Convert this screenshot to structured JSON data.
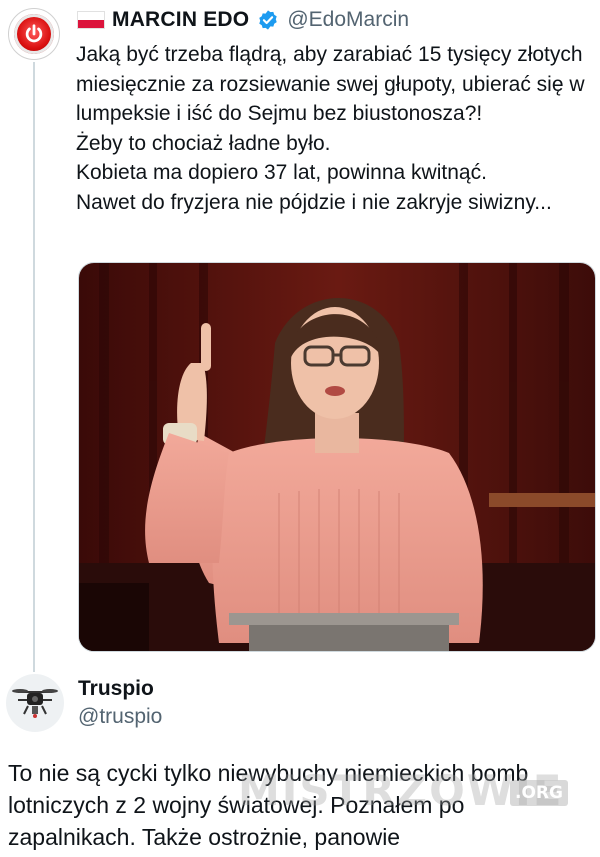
{
  "tweet1": {
    "display_name": "MARCIN EDO",
    "handle": "@EdoMarcin",
    "flag_colors": [
      "#ffffff",
      "#dc143c"
    ],
    "verified_color": "#1d9bf0",
    "lines": [
      "Jaką być trzeba flądrą, aby zarabiać 15 tysięcy złotych miesięcznie za rozsiewanie swej głupoty, ubierać się w lumpeksie i iść do Sejmu bez biustonosza?!",
      "Żeby to chociaż ładne było.",
      "Kobieta ma dopiero 37 lat, powinna kwitnąć.",
      "Nawet do fryzjera nie pójdzie i nie zakryje siwizny..."
    ],
    "avatar_icon": "power-button-icon"
  },
  "tweet2": {
    "display_name": "Truspio",
    "handle": "@truspio",
    "avatar_icon": "drone-icon",
    "text": "To nie są cycki tylko niewybuchy niemieckich bomb lotniczych z 2 wojny światowej. Poznałem po zapalnikach. Także ostrożnie, panowie"
  },
  "watermark": {
    "text": "MISTRZOWIE",
    "suffix": ".ORG"
  },
  "colors": {
    "text": "#0f1419",
    "secondary": "#536471",
    "thread_line": "#cfd9de"
  }
}
